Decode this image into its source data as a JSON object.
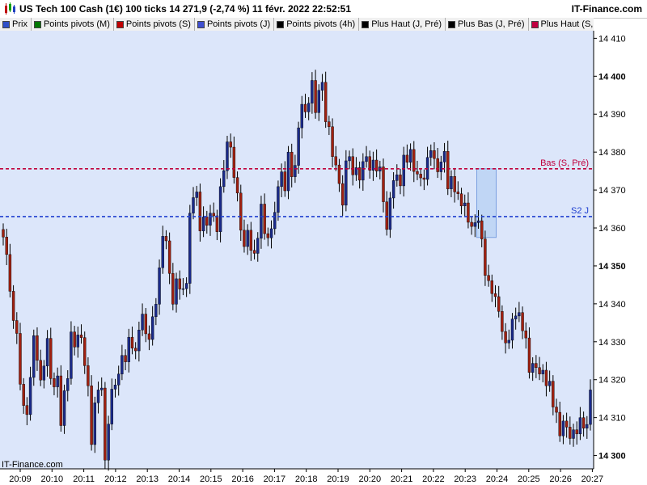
{
  "header": {
    "title": "US Tech 100 Cash (1€) 100 ticks 14 271,9 (-2,74 %) 11 févr. 2022 22:52:51",
    "brand": "IT-Finance.com"
  },
  "legend": [
    {
      "label": "Prix",
      "color": "#3050c8"
    },
    {
      "label": "Points pivots (M)",
      "color": "#007700"
    },
    {
      "label": "Points pivots (S)",
      "color": "#c00000"
    },
    {
      "label": "Points pivots (J)",
      "color": "#4050d0"
    },
    {
      "label": "Points pivots (4h)",
      "color": "#000000"
    },
    {
      "label": "Plus Haut (J, Pré)",
      "color": "#000000"
    },
    {
      "label": "Plus Bas (J, Pré)",
      "color": "#000000"
    },
    {
      "label": "Plus Haut (S, Pré)",
      "color": "#c00040"
    }
  ],
  "footer": {
    "brand": "IT-Finance.com"
  },
  "colors": {
    "plot_bg": "#dce6fa",
    "up": "#1a2a8a",
    "down": "#a02010",
    "bas_line": "#c0003c",
    "s2_line": "#2040d0",
    "highlight": "#aac8f0"
  },
  "chart_data": {
    "type": "candlestick",
    "x_ticks": [
      "20:09",
      "20:10",
      "20:11",
      "20:12",
      "20:13",
      "20:14",
      "20:15",
      "20:16",
      "20:17",
      "20:18",
      "20:19",
      "20:20",
      "20:21",
      "20:22",
      "20:23",
      "20:24",
      "20:25",
      "20:26",
      "20:27"
    ],
    "y_ticks": [
      14300,
      14310,
      14320,
      14330,
      14340,
      14350,
      14360,
      14370,
      14380,
      14390,
      14400,
      14410
    ],
    "y_tick_labels": [
      "14 300",
      "14 310",
      "14 320",
      "14 330",
      "14 340",
      "14 350",
      "14 360",
      "14 370",
      "14 380",
      "14 390",
      "14 400",
      "14 410"
    ],
    "y_range": [
      14296.5,
      14412
    ],
    "grid": false,
    "reference_lines": [
      {
        "name": "Bas (S, Pré)",
        "value": 14375.6
      },
      {
        "name": "S2 J",
        "value": 14363.0
      }
    ],
    "highlight": {
      "y_range": [
        14357.5,
        14375.6
      ]
    },
    "closes": [
      14357.6,
      14353.0,
      14343.3,
      14335.6,
      14332.2,
      14318.8,
      14313.2,
      14310.8,
      14320.6,
      14331.6,
      14325.1,
      14319.9,
      14323.6,
      14330.9,
      14320.3,
      14318.1,
      14321.0,
      14307.9,
      14317.1,
      14320.3,
      14332.6,
      14328.6,
      14331.8,
      14331.1,
      14323.7,
      14318.4,
      14302.9,
      14313.9,
      14317.3,
      14317.8,
      14298.8,
      14308.3,
      14317.5,
      14318.6,
      14321.5,
      14326.4,
      14324.7,
      14331.2,
      14328.3,
      14327.6,
      14333.1,
      14337.3,
      14332.1,
      14330.6,
      14336.6,
      14339.9,
      14349.5,
      14357.8,
      14356.6,
      14348.0,
      14339.9,
      14346.6,
      14343.9,
      14344.0,
      14345.4,
      14363.9,
      14368.0,
      14369.5,
      14359.2,
      14362.9,
      14360.7,
      14363.9,
      14363.2,
      14359.0,
      14370.9,
      14375.1,
      14382.7,
      14381.3,
      14373.3,
      14369.2,
      14359.4,
      14355.1,
      14359.4,
      14354.1,
      14353.3,
      14357.3,
      14366.3,
      14358.5,
      14357.4,
      14359.8,
      14364.1,
      14370.9,
      14374.8,
      14369.8,
      14380.0,
      14373.5,
      14376.5,
      14386.4,
      14392.6,
      14390.6,
      14392.9,
      14398.9,
      14390.4,
      14396.3,
      14398.4,
      14388.0,
      14386.7,
      14378.8,
      14376.6,
      14371.7,
      14366.0,
      14377.7,
      14378.8,
      14374.0,
      14375.9,
      14372.6,
      14377.5,
      14378.8,
      14375.2,
      14377.9,
      14375.0,
      14376.1,
      14366.9,
      14359.6,
      14367.9,
      14372.5,
      14374.0,
      14371.1,
      14379.2,
      14377.3,
      14380.7,
      14374.9,
      14374.2,
      14373.2,
      14372.8,
      14378.6,
      14380.4,
      14378.3,
      14374.8,
      14377.4,
      14380.2,
      14370.3,
      14373.6,
      14369.5,
      14369.0,
      14365.8,
      14366.6,
      14361.5,
      14360.4,
      14361.4,
      14361.9,
      14357.1,
      14347.5,
      14346.1,
      14342.7,
      14341.9,
      14338.0,
      14332.7,
      14329.7,
      14330.4,
      14336.0,
      14336.8,
      14337.7,
      14332.9,
      14331.0,
      14321.9,
      14324.3,
      14323.2,
      14321.5,
      14322.5,
      14318.4,
      14319.6,
      14312.8,
      14311.4,
      14305.2,
      14309.1,
      14307.5,
      14304.5,
      14306.8,
      14305.7,
      14310.0,
      14307.2,
      14308.2,
      14317.3
    ]
  }
}
